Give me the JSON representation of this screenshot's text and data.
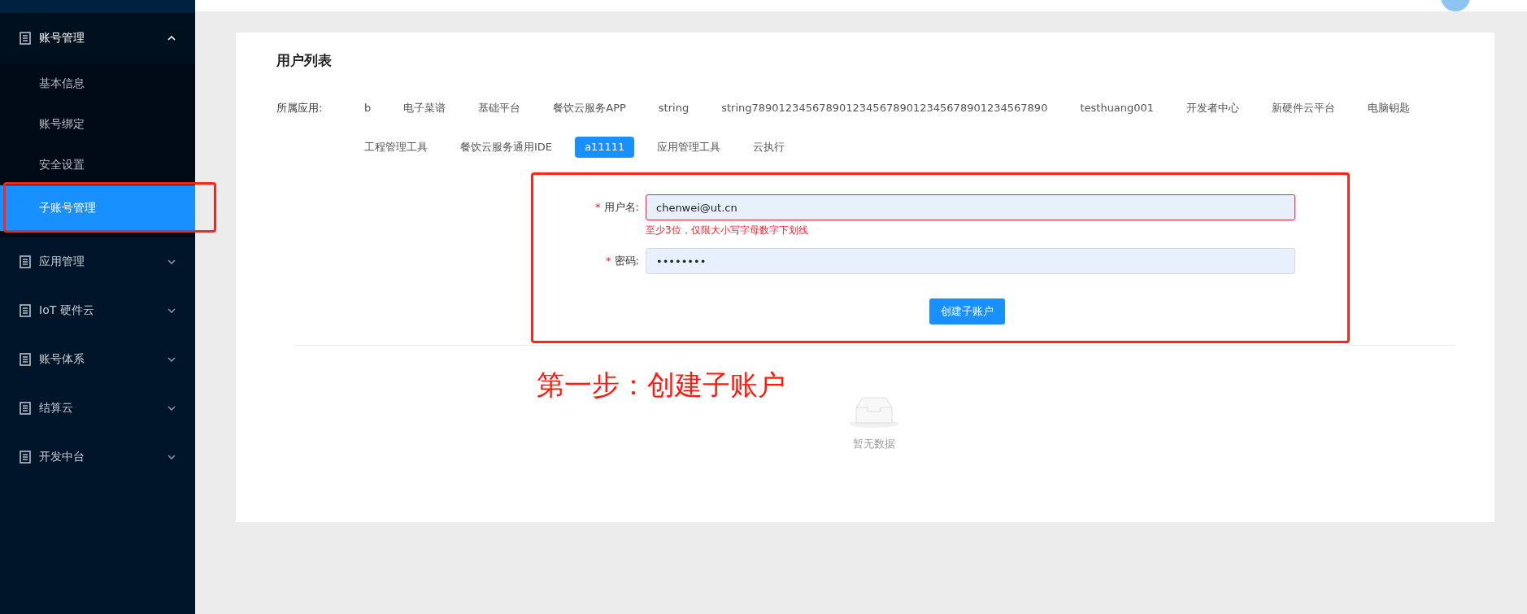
{
  "sidebar": {
    "groups": [
      {
        "label": "账号管理",
        "expanded": true,
        "children": [
          {
            "label": "基本信息",
            "selected": false
          },
          {
            "label": "账号绑定",
            "selected": false
          },
          {
            "label": "安全设置",
            "selected": false
          },
          {
            "label": "子账号管理",
            "selected": true
          }
        ]
      },
      {
        "label": "应用管理",
        "expanded": false
      },
      {
        "label": "IoT 硬件云",
        "expanded": false
      },
      {
        "label": "账号体系",
        "expanded": false
      },
      {
        "label": "结算云",
        "expanded": false
      },
      {
        "label": "开发中台",
        "expanded": false
      }
    ]
  },
  "page": {
    "title": "用户列表",
    "app_filter": {
      "label": "所属应用:",
      "tabs": [
        {
          "label": "b",
          "selected": false
        },
        {
          "label": "电子菜谱",
          "selected": false
        },
        {
          "label": "基础平台",
          "selected": false
        },
        {
          "label": "餐饮云服务APP",
          "selected": false
        },
        {
          "label": "string",
          "selected": false
        },
        {
          "label": "string78901234567890123456789012345678901234567890",
          "selected": false
        },
        {
          "label": "testhuang001",
          "selected": false
        },
        {
          "label": "开发者中心",
          "selected": false
        },
        {
          "label": "新硬件云平台",
          "selected": false
        },
        {
          "label": "电脑钥匙",
          "selected": false
        },
        {
          "label": "工程管理工具",
          "selected": false
        },
        {
          "label": "餐饮云服务通用IDE",
          "selected": false
        },
        {
          "label": "a11111",
          "selected": true
        },
        {
          "label": "应用管理工具",
          "selected": false
        },
        {
          "label": "云执行",
          "selected": false
        }
      ]
    },
    "form": {
      "fields": [
        {
          "label": "用户名:",
          "required_mark": "*",
          "value": "chenwei@ut.cn",
          "invalid": true,
          "error": "至少3位，仅限大小写字母数字下划线"
        },
        {
          "label": "密码:",
          "required_mark": "*",
          "value": "••••••••",
          "invalid": false
        }
      ],
      "submit": "创建子账户"
    },
    "annotation": "第一步：创建子账户",
    "empty_text": "暂无数据"
  }
}
